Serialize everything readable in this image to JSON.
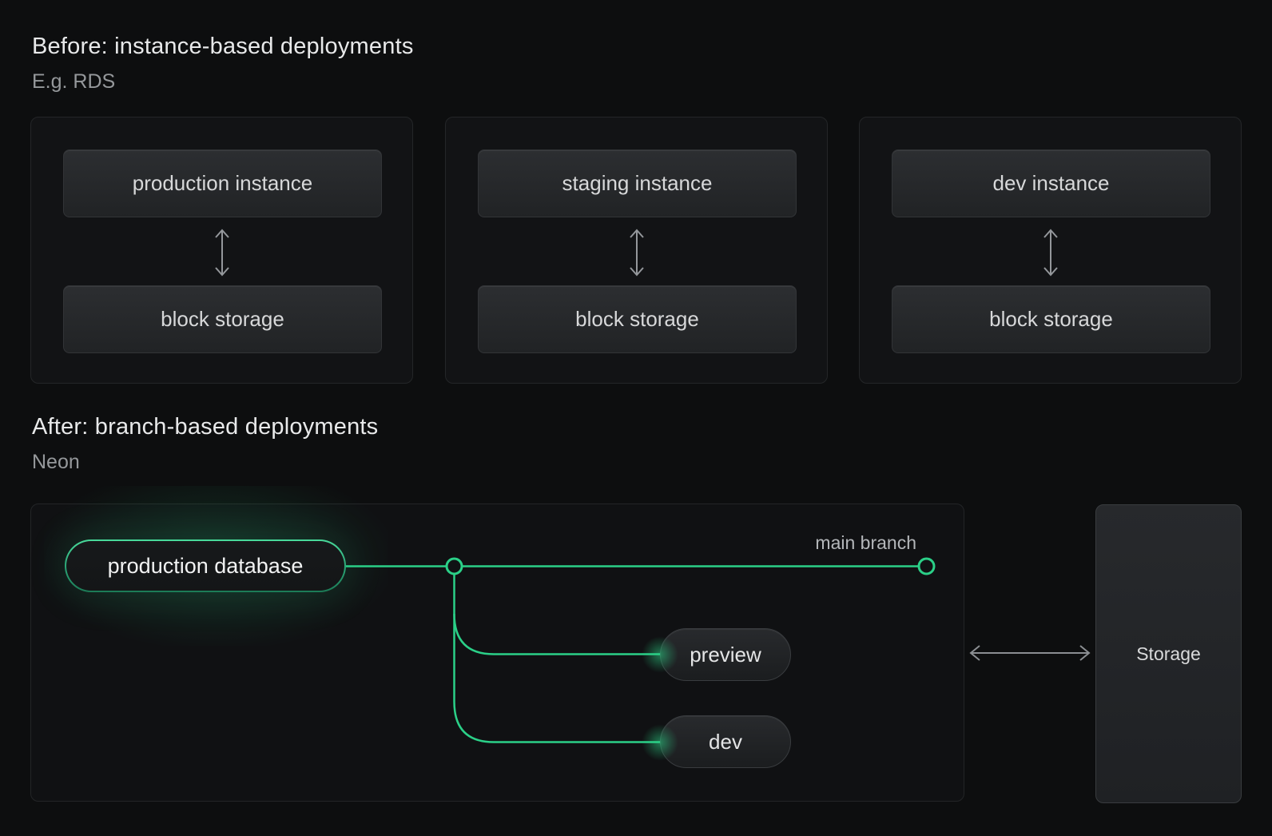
{
  "before": {
    "title": "Before: instance-based deployments",
    "subtitle": "E.g. RDS",
    "cards": [
      {
        "instance_label": "production instance",
        "storage_label": "block storage"
      },
      {
        "instance_label": "staging instance",
        "storage_label": "block storage"
      },
      {
        "instance_label": "dev instance",
        "storage_label": "block storage"
      }
    ]
  },
  "after": {
    "title": "After: branch-based deployments",
    "subtitle": "Neon",
    "production_pill_label": "production database",
    "main_branch_label": "main branch",
    "branch_pills": [
      {
        "label": "preview"
      },
      {
        "label": "dev"
      }
    ],
    "storage_label": "Storage"
  },
  "colors": {
    "background": "#0d0e0f",
    "accent_green": "#2bd088",
    "card_background": "#121315",
    "card_border": "#242628",
    "box_gradient_top": "#2c2e31",
    "box_gradient_bottom": "#212325",
    "text_primary": "#e8e9ea",
    "text_secondary": "#95989b",
    "arrow_gray": "#8d9093"
  }
}
